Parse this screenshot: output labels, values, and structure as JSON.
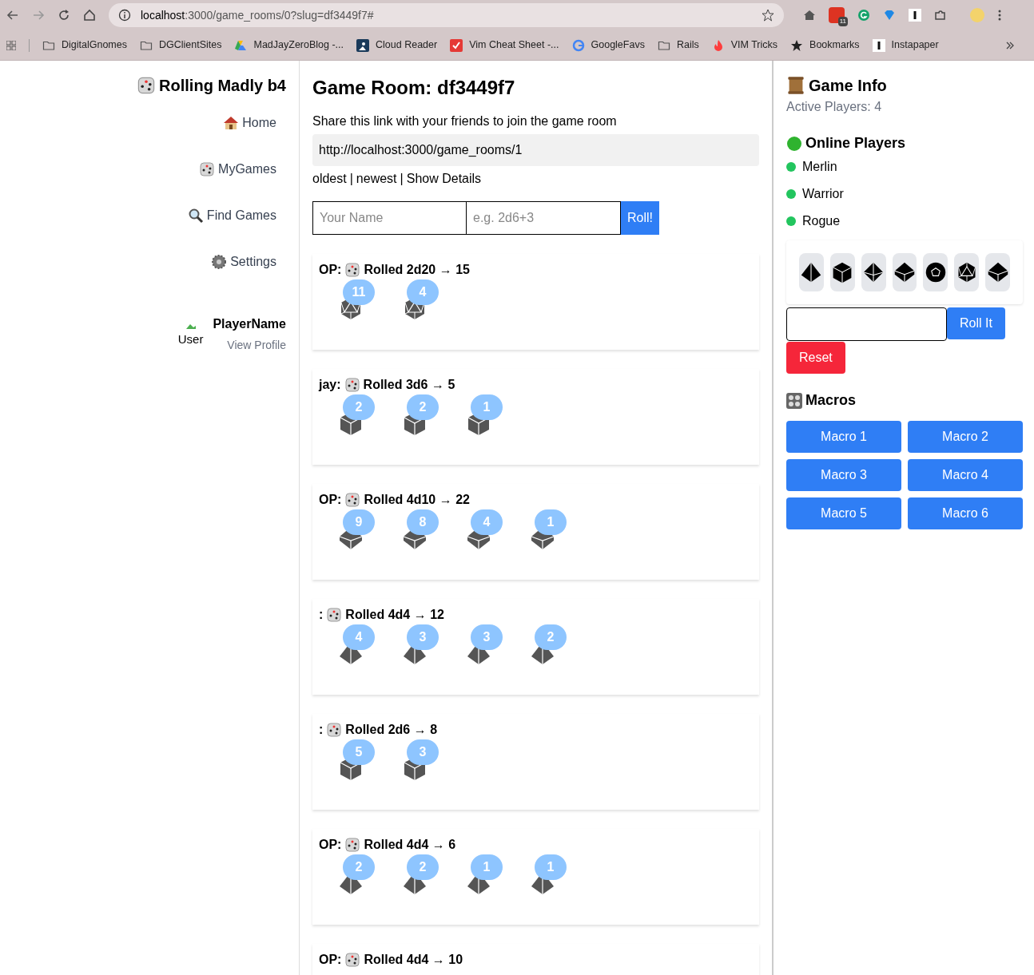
{
  "browser": {
    "url_host": "localhost",
    "url_rest": ":3000/game_rooms/0?slug=df3449f7#",
    "extension_badge": "11",
    "bookmarks": [
      {
        "kind": "folder",
        "label": "DigitalGnomes"
      },
      {
        "kind": "folder",
        "label": "DGClientSites"
      },
      {
        "kind": "drive",
        "label": "MadJayZeroBlog -..."
      },
      {
        "kind": "reader",
        "label": "Cloud Reader"
      },
      {
        "kind": "vim",
        "label": "Vim Cheat Sheet -..."
      },
      {
        "kind": "google",
        "label": "GoogleFavs"
      },
      {
        "kind": "folder",
        "label": "Rails"
      },
      {
        "kind": "flame",
        "label": "VIM Tricks"
      },
      {
        "kind": "star",
        "label": "Bookmarks"
      },
      {
        "kind": "instapaper",
        "label": "Instapaper"
      }
    ]
  },
  "sidebar": {
    "title": "Rolling Madly b4",
    "nav": [
      {
        "kind": "home",
        "label": "Home"
      },
      {
        "kind": "dice",
        "label": "MyGames"
      },
      {
        "kind": "search",
        "label": "Find Games"
      },
      {
        "kind": "gear",
        "label": "Settings"
      }
    ],
    "user": {
      "avatar_alt": "User",
      "name": "PlayerName",
      "link": "View Profile"
    }
  },
  "room": {
    "title": "Game Room: df3449f7",
    "share_text": "Share this link with your friends to join the game room",
    "share_link": "http://localhost:3000/game_rooms/1",
    "sort_links": [
      "oldest",
      "newest",
      "Show Details"
    ],
    "sort_separator": "|",
    "name_placeholder": "Your Name",
    "roll_placeholder": "e.g. 2d6+3",
    "roll_button": "Roll!",
    "rolls": [
      {
        "player": "OP:",
        "text": "Rolled 2d20 → 15",
        "dice": [
          {
            "kind": "d20",
            "value": "11"
          },
          {
            "kind": "d20",
            "value": "4"
          }
        ]
      },
      {
        "player": "jay:",
        "text": "Rolled 3d6 → 5",
        "dice": [
          {
            "kind": "d6",
            "value": "2"
          },
          {
            "kind": "d6",
            "value": "2"
          },
          {
            "kind": "d6",
            "value": "1"
          }
        ]
      },
      {
        "player": "OP:",
        "text": "Rolled 4d10 → 22",
        "dice": [
          {
            "kind": "d10",
            "value": "9"
          },
          {
            "kind": "d10",
            "value": "8"
          },
          {
            "kind": "d10",
            "value": "4"
          },
          {
            "kind": "d10",
            "value": "1"
          }
        ]
      },
      {
        "player": ":",
        "text": "Rolled 4d4 → 12",
        "dice": [
          {
            "kind": "d4",
            "value": "4"
          },
          {
            "kind": "d4",
            "value": "3"
          },
          {
            "kind": "d4",
            "value": "3"
          },
          {
            "kind": "d4",
            "value": "2"
          }
        ]
      },
      {
        "player": ":",
        "text": "Rolled 2d6 → 8",
        "dice": [
          {
            "kind": "d6",
            "value": "5"
          },
          {
            "kind": "d6",
            "value": "3"
          }
        ]
      },
      {
        "player": "OP:",
        "text": "Rolled 4d4 → 6",
        "dice": [
          {
            "kind": "d4",
            "value": "2"
          },
          {
            "kind": "d4",
            "value": "2"
          },
          {
            "kind": "d4",
            "value": "1"
          },
          {
            "kind": "d4",
            "value": "1"
          }
        ]
      },
      {
        "player": "OP:",
        "text": "Rolled 4d4 → 10"
      }
    ]
  },
  "game_info": {
    "title": "Game Info",
    "active_players": "Active Players: 4",
    "online_title": "Online Players",
    "players": [
      {
        "name": "Merlin",
        "color": "#22c55e"
      },
      {
        "name": "Warrior",
        "color": "#22c55e"
      },
      {
        "name": "Rogue",
        "color": "#22c55e"
      }
    ],
    "dice_tray": [
      {
        "kind": "d4"
      },
      {
        "kind": "d6"
      },
      {
        "kind": "d8"
      },
      {
        "kind": "d10"
      },
      {
        "kind": "d12"
      },
      {
        "kind": "d20"
      },
      {
        "kind": "d10"
      }
    ],
    "roll_button": "Roll It",
    "reset_button": "Reset",
    "macros_title": "Macros",
    "macros": [
      "Macro 1",
      "Macro 2",
      "Macro 3",
      "Macro 4",
      "Macro 5",
      "Macro 6"
    ]
  }
}
